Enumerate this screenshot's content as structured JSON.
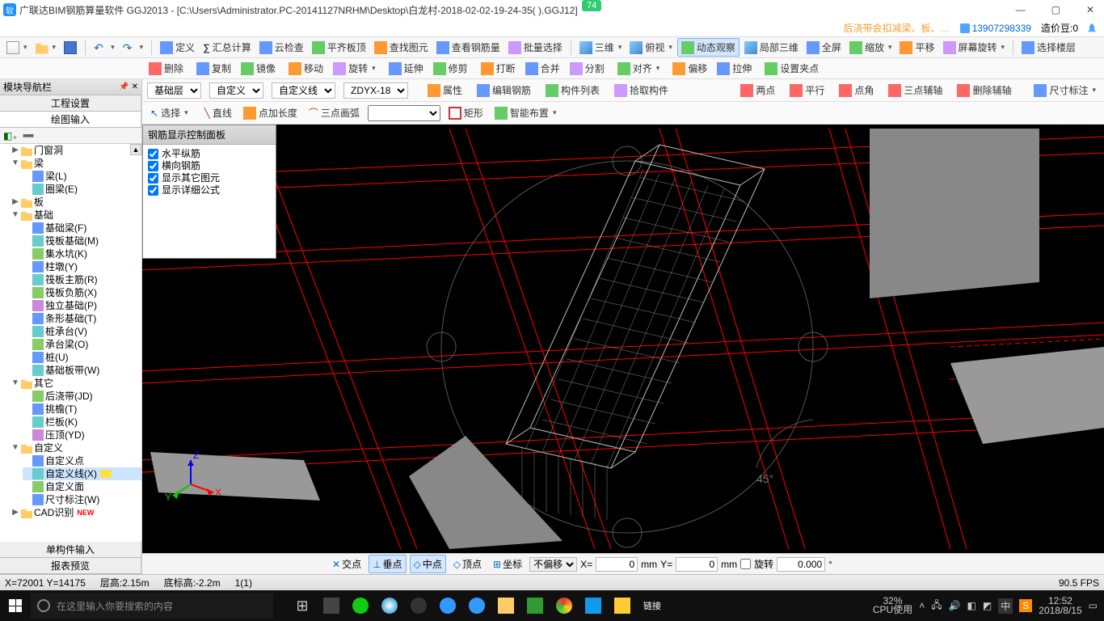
{
  "title": "广联达BIM钢筋算量软件 GGJ2013 - [C:\\Users\\Administrator.PC-20141127NRHM\\Desktop\\白龙村-2018-02-02-19-24-35(        ).GGJ12]",
  "badge": "74",
  "info": {
    "warning": "后浇带会扣减梁、板、…",
    "account": "13907298339",
    "price_label": "造价豆:0"
  },
  "toolbar1": {
    "define": "定义",
    "sum": "汇总计算",
    "cloud": "云检查",
    "flat": "平齐板顶",
    "find": "查找图元",
    "viewqty": "查看钢筋量",
    "batch": "批量选择",
    "threeD": "三维",
    "top": "俯视",
    "dynview": "动态观察",
    "local3d": "局部三维",
    "full": "全屏",
    "zoom": "缩放",
    "pan": "平移",
    "screenrot": "屏幕旋转",
    "selfloor": "选择楼层"
  },
  "toolbar2": {
    "delete": "删除",
    "copy": "复制",
    "mirror": "镜像",
    "move": "移动",
    "rotate": "旋转",
    "extend": "延伸",
    "trim": "修剪",
    "break": "打断",
    "merge": "合并",
    "split": "分割",
    "align": "对齐",
    "offset": "偏移",
    "stretch": "拉伸",
    "setgrip": "设置夹点"
  },
  "propbar": {
    "floor": "基础层",
    "custom": "自定义",
    "customline": "自定义线",
    "code": "ZDYX-18",
    "attr": "属性",
    "editrebar": "编辑钢筋",
    "complist": "构件列表",
    "pick": "拾取构件",
    "two": "两点",
    "parallel": "平行",
    "ptang": "点角",
    "threept": "三点辅轴",
    "delaux": "删除辅轴",
    "dim": "尺寸标注"
  },
  "drawbar": {
    "select": "选择",
    "line": "直线",
    "ptlen": "点加长度",
    "arc3": "三点画弧",
    "rect": "矩形",
    "smart": "智能布置"
  },
  "sidebar": {
    "header": "模块导航栏",
    "tab1": "工程设置",
    "tab2": "绘图输入",
    "groups": {
      "doorwin": "门窗洞",
      "beam": "梁",
      "beam_l": "梁(L)",
      "ringbeam": "圈梁(E)",
      "slab": "板",
      "foundation": "基础",
      "fbeam_f": "基础梁(F)",
      "raft_m": "筏板基础(M)",
      "sump_k": "集水坑(K)",
      "pier_y": "柱墩(Y)",
      "raftmain_r": "筏板主筋(R)",
      "raftneg_x": "筏板负筋(X)",
      "iso_p": "独立基础(P)",
      "strip_t": "条形基础(T)",
      "capV": "桩承台(V)",
      "capbeam_o": "承台梁(O)",
      "pile_u": "桩(U)",
      "fslab_w": "基础板带(W)",
      "other": "其它",
      "postpour": "后浇带(JD)",
      "tiaoyan": "挑檐(T)",
      "railing": "栏板(K)",
      "yading": "压顶(YD)",
      "custom": "自定义",
      "cpoint": "自定义点",
      "cline": "自定义线(X)",
      "cface": "自定义面",
      "dim_w": "尺寸标注(W)",
      "cad": "CAD识别"
    },
    "bottom1": "单构件输入",
    "bottom2": "报表预览"
  },
  "rebar_panel": {
    "title": "钢筋显示控制面板",
    "items": [
      "水平纵筋",
      "横向钢筋",
      "显示其它图元",
      "显示详细公式"
    ]
  },
  "angle": "45°",
  "snap": {
    "inter": "交点",
    "perp": "垂点",
    "mid": "中点",
    "vert": "顶点",
    "coord": "坐标",
    "nooffset": "不偏移",
    "x_label": "X=",
    "x": "0",
    "mm": "mm",
    "y_label": "Y=",
    "y": "0",
    "rotate_label": "旋转",
    "rotate": "0.000",
    "deg": "°"
  },
  "status": {
    "xy": "X=72001 Y=14175",
    "floorH": "层高:2.15m",
    "baseH": "底标高:-2.2m",
    "sel": "1(1)",
    "fps": "90.5 FPS"
  },
  "taskbar": {
    "search_ph": "在这里输入你要搜索的内容",
    "link": "链接",
    "cpu_pct": "32%",
    "cpu_lbl": "CPU使用",
    "ime": "中",
    "time": "12:52",
    "date": "2018/8/15"
  }
}
